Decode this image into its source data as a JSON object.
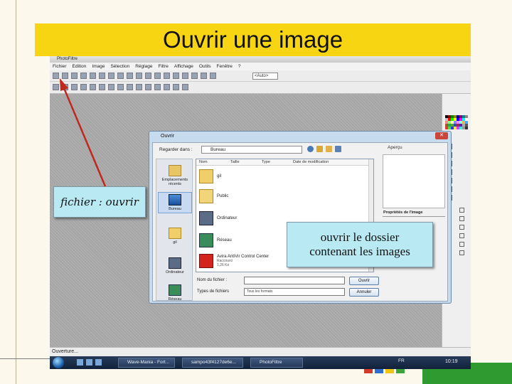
{
  "slide": {
    "title": "Ouvrir une image",
    "accent_color": "#f8d512",
    "brand_green": "#2f9a2f"
  },
  "app": {
    "window_title": "PhotoFiltre",
    "menu": [
      "Fichier",
      "Edition",
      "Image",
      "Sélection",
      "Réglage",
      "Filtre",
      "Affichage",
      "Outils",
      "Fenêtre",
      "?"
    ],
    "zoom_value": "<Auto>",
    "status_text": "Ouverture..."
  },
  "dialog": {
    "title": "Ouvrir",
    "lookin_label": "Regarder dans :",
    "lookin_value": "Bureau",
    "columns": [
      "Nom",
      "Taille",
      "Type",
      "Date de modification"
    ],
    "places": [
      {
        "label": "Emplacements récents",
        "icon": "recent-places-icon"
      },
      {
        "label": "Bureau",
        "icon": "desktop-icon"
      },
      {
        "label": "gil",
        "icon": "user-folder-icon"
      },
      {
        "label": "Ordinateur",
        "icon": "computer-icon"
      },
      {
        "label": "Réseau",
        "icon": "network-icon"
      }
    ],
    "files": [
      {
        "name": "gil",
        "icon": "user-folder-icon",
        "sub": ""
      },
      {
        "name": "Public",
        "icon": "folder-icon",
        "sub": ""
      },
      {
        "name": "Ordinateur",
        "icon": "computer-icon",
        "sub": ""
      },
      {
        "name": "Réseau",
        "icon": "network-icon",
        "sub": ""
      },
      {
        "name": "Avira AntiVir Control Center",
        "icon": "avira-icon",
        "sub": "Raccourci",
        "sub2": "1,26 Ko"
      }
    ],
    "preview_label": "Aperçu",
    "props_label": "Propriétés de l'image",
    "filename_label": "Nom du fichier :",
    "filename_value": "",
    "filetype_label": "Types de fichiers",
    "filetype_value": "Tous les formats",
    "open_button": "Ouvrir",
    "cancel_button": "Annuler"
  },
  "taskbar": {
    "tasks": [
      "Wave-Mania - Fort...",
      "sampo43f4127de6e...",
      "PhotoFiltre"
    ],
    "tray_lang": "FR",
    "clock": "10:19"
  },
  "callouts": {
    "menu_hint": "fichier : ouvrir",
    "folder_hint_line1": "ouvrir le dossier",
    "folder_hint_line2": "contenant les images"
  }
}
